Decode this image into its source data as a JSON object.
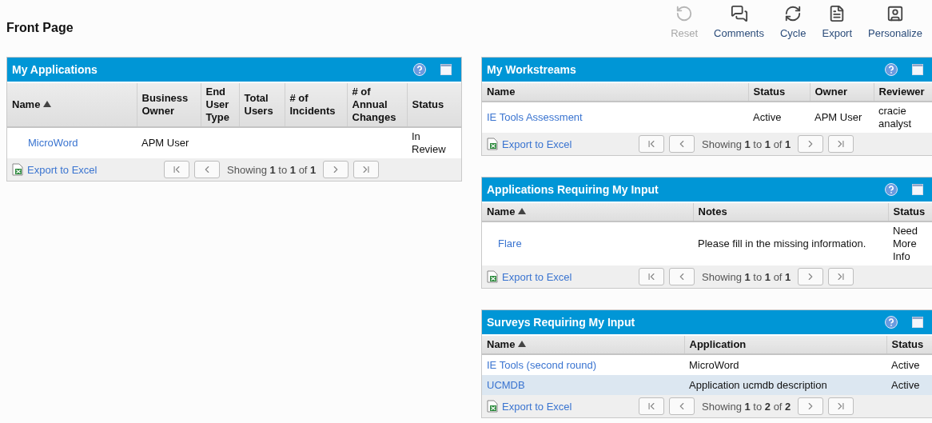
{
  "page": {
    "title": "Front Page"
  },
  "toolbar": [
    {
      "kind": "reset",
      "label": "Reset",
      "disabled": true
    },
    {
      "kind": "comments",
      "label": "Comments",
      "disabled": false
    },
    {
      "kind": "cycle",
      "label": "Cycle",
      "disabled": false
    },
    {
      "kind": "export",
      "label": "Export",
      "disabled": false
    },
    {
      "kind": "personalize",
      "label": "Personalize",
      "disabled": false
    }
  ],
  "panels": [
    {
      "title": "My Applications",
      "columns": [
        {
          "label": "Name",
          "sorted": true
        },
        {
          "label": "Business Owner",
          "sorted": false
        },
        {
          "label": "End User Type",
          "sorted": false
        },
        {
          "label": "Total Users",
          "sorted": false
        },
        {
          "label": "# of Incidents",
          "sorted": false
        },
        {
          "label": "# of Annual Changes",
          "sorted": false
        },
        {
          "label": "Status",
          "sorted": false
        }
      ],
      "rows": [
        {
          "selected": false,
          "cells": [
            "MicroWord",
            "APM User",
            null,
            null,
            null,
            null,
            "In Review"
          ]
        }
      ],
      "export": "Export to Excel",
      "paging": "Showing **1** to **1** of **1**"
    },
    {
      "title": "My Workstreams",
      "columns": [
        {
          "label": "Name",
          "sorted": false
        },
        {
          "label": "Status",
          "sorted": false
        },
        {
          "label": "Owner",
          "sorted": false
        },
        {
          "label": "Reviewer",
          "sorted": false
        }
      ],
      "rows": [
        {
          "selected": false,
          "cells": [
            "IE Tools Assessment",
            "Active",
            "APM User",
            "cracie analyst"
          ]
        }
      ],
      "export": "Export to Excel",
      "paging": "Showing **1** to **1** of **1**"
    },
    {
      "title": "Applications Requiring My Input",
      "columns": [
        {
          "label": "Name",
          "sorted": true
        },
        {
          "label": "Notes",
          "sorted": false
        },
        {
          "label": "Status",
          "sorted": false
        }
      ],
      "rows": [
        {
          "selected": false,
          "cells": [
            "Flare",
            "Please fill in the missing information.",
            "Need More Info"
          ]
        }
      ],
      "export": "Export to Excel",
      "paging": "Showing **1** to **1** of **1**"
    },
    {
      "title": "Surveys Requiring My Input",
      "columns": [
        {
          "label": "Name",
          "sorted": true
        },
        {
          "label": "Application",
          "sorted": false
        },
        {
          "label": "Status",
          "sorted": false
        }
      ],
      "rows": [
        {
          "selected": false,
          "cells": [
            "IE Tools (second round)",
            "MicroWord",
            "Active"
          ]
        },
        {
          "selected": true,
          "cells": [
            "UCMDB",
            "Application ucmdb description",
            "Active"
          ]
        }
      ],
      "export": "Export to Excel",
      "paging": "Showing **1** to **2** of **2**"
    }
  ]
}
